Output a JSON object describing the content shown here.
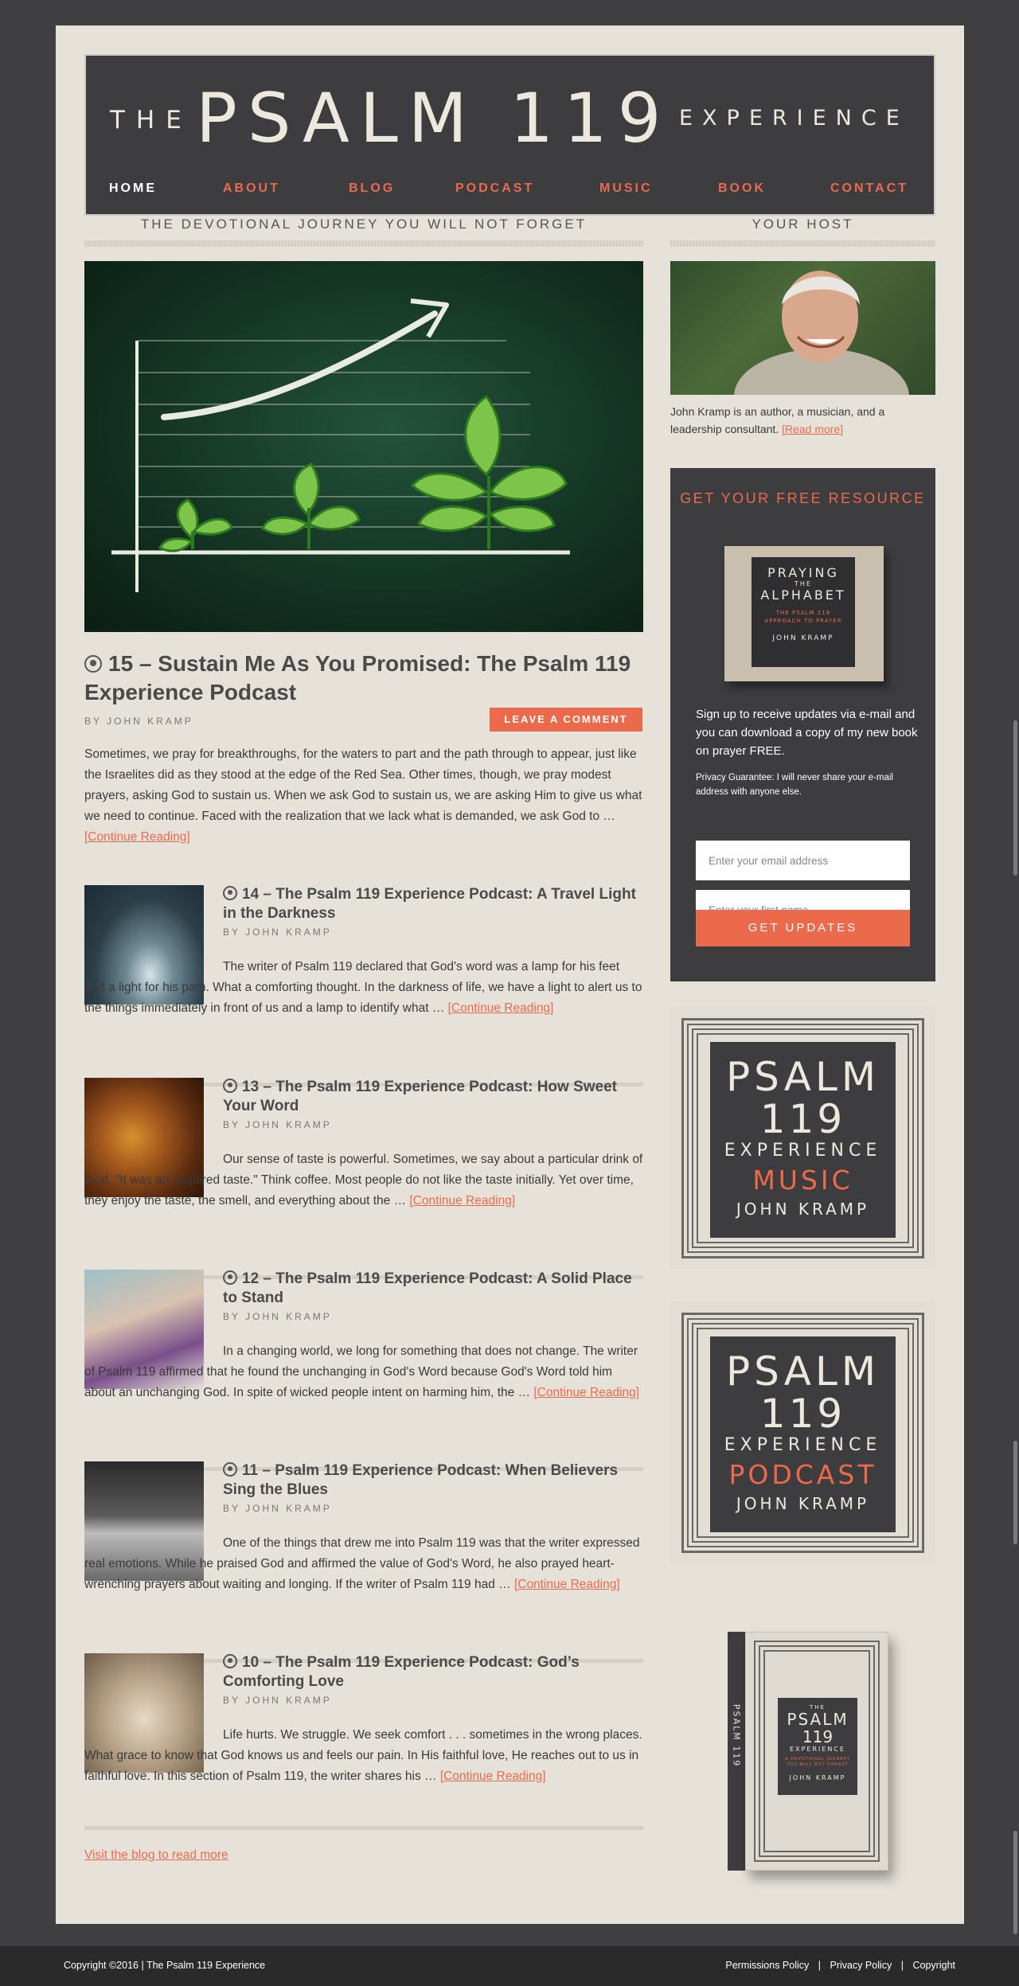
{
  "header": {
    "the": "THE",
    "psalm": "PSALM 119",
    "experience": "EXPERIENCE",
    "nav": [
      "HOME",
      "ABOUT",
      "BLOG",
      "PODCAST",
      "MUSIC",
      "BOOK",
      "CONTACT"
    ],
    "active_nav": "HOME"
  },
  "main": {
    "heading": "THE DEVOTIONAL JOURNEY YOU WILL NOT FORGET",
    "feature": {
      "title": "15 – Sustain Me As You Promised: The Psalm 119 Experience Podcast",
      "byline": "BY JOHN KRAMP",
      "comment_button": "LEAVE A COMMENT",
      "excerpt": "Sometimes, we pray for breakthroughs, for the waters to part and the path through to appear, just like the Israelites did as they stood at the edge of the Red Sea. Other times, though, we pray modest prayers, asking God to sustain us. When we ask God to sustain us, we are asking Him to give us what we need to continue. Faced with the realization that we lack what is demanded, we ask God to … ",
      "more": "[Continue Reading]"
    },
    "posts": [
      {
        "title": "14 – The Psalm 119 Experience Podcast: A Travel Light in the Darkness",
        "byline": "BY JOHN KRAMP",
        "excerpt": "The writer of Psalm 119 declared that God's word was a lamp for his feet and a light for his path. What a comforting thought. In the darkness of life, we have a light to alert us to the things immediately in front of us and a lamp to identify what … ",
        "more": "[Continue Reading]"
      },
      {
        "title": "13 – The Psalm 119 Experience Podcast: How Sweet Your Word",
        "byline": "BY JOHN KRAMP",
        "excerpt": "Our sense of taste is powerful. Sometimes, we say about a particular drink of food, \"It was an acquired taste.\" Think coffee. Most people do not like the taste initially. Yet over time, they enjoy the taste, the smell, and everything about the … ",
        "more": "[Continue Reading]"
      },
      {
        "title": "12 – The Psalm 119 Experience Podcast: A Solid Place to Stand",
        "byline": "BY JOHN KRAMP",
        "excerpt": "In a changing world, we long for something that does not change. The writer of Psalm 119 affirmed that he found the unchanging in God's Word because God's Word told him about an unchanging God. In spite of wicked people intent on harming him, the … ",
        "more": "[Continue Reading]"
      },
      {
        "title": "11 – Psalm 119 Experience Podcast: When Believers Sing the Blues",
        "byline": "BY JOHN KRAMP",
        "excerpt": "One of the things that drew me into Psalm 119 was that the writer expressed real emotions. While he praised God and affirmed the value of God's Word, he also prayed heart-wrenching prayers about waiting and longing. If the writer of Psalm 119 had … ",
        "more": "[Continue Reading]"
      },
      {
        "title": "10 – The Psalm 119 Experience Podcast: God’s Comforting Love",
        "byline": "BY JOHN KRAMP",
        "excerpt": "Life hurts. We struggle. We seek comfort . . . sometimes in the wrong places. What grace to know that God knows us and feels our pain. In His faithful love, He reaches out to us in faithful love. In this section of Psalm 119, the writer shares his … ",
        "more": "[Continue Reading]"
      }
    ],
    "visit_link": "Visit the blog to read more"
  },
  "sidebar": {
    "heading": "YOUR HOST",
    "bio": "John Kramp is an author, a musician, and a leadership consultant. ",
    "bio_more": "[Read more]",
    "optin": {
      "title": "GET YOUR FREE RESOURCE",
      "book": {
        "l1": "PRAYING",
        "l2": "THE",
        "l3": "ALPHABET",
        "sub": "THE PSALM 119 APPROACH TO PRAYER",
        "author": "JOHN KRAMP"
      },
      "text": "Sign up to receive updates via e-mail and you can download a copy of my new book on prayer FREE.",
      "privacy": "Privacy Guarantee: I will never share your e-mail address with anyone else.",
      "email_placeholder": "Enter your email address",
      "name_placeholder": "Enter your first name",
      "button": "GET UPDATES"
    },
    "promo_music": {
      "l1": "PSALM",
      "l2": "119",
      "l3": "EXPERIENCE",
      "l4": "MUSIC",
      "l5": "JOHN KRAMP"
    },
    "promo_podcast": {
      "l1": "PSALM",
      "l2": "119",
      "l3": "EXPERIENCE",
      "l4": "PODCAST",
      "l5": "JOHN KRAMP"
    },
    "book": {
      "spine": "PSALM 119",
      "the": "THE",
      "l1": "PSALM",
      "l2": "119",
      "l3": "EXPERIENCE",
      "tagline": "A DEVOTIONAL JOURNEY YOU WILL NOT FORGET",
      "author": "JOHN KRAMP"
    }
  },
  "footer": {
    "copyright": "Copyright ©2016  |  The Psalm 119 Experience",
    "links": [
      "Permissions Policy",
      "Privacy Policy",
      "Copyright"
    ],
    "separator": "|"
  },
  "colors": {
    "accent": "#ec6a4c",
    "dark_panel": "#3d3c3f",
    "paper": "#e6e2da",
    "background": "#3f3f41"
  }
}
